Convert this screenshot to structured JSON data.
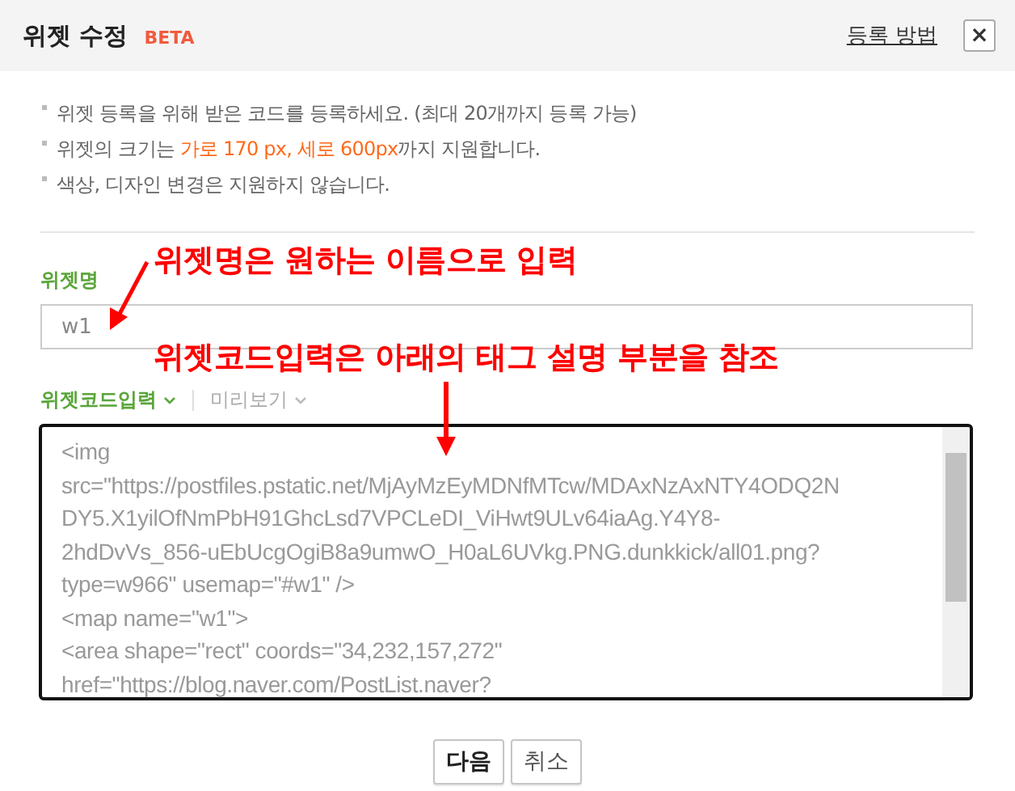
{
  "header": {
    "title": "위젯 수정",
    "badge": "BETA",
    "help_link": "등록 방법",
    "close_label": "×"
  },
  "notes": [
    "위젯 등록을 위해 받은 코드를 등록하세요. (최대 20개까지 등록 가능)",
    "위젯의 크기는 **가로 170 px, 세로 600px**까지 지원합니다.",
    "색상, 디자인 변경은 지원하지 않습니다."
  ],
  "name_field": {
    "label": "위젯명",
    "value": "w1"
  },
  "code_tabs": [
    {
      "label": "위젯코드입력",
      "selected": true
    },
    {
      "label": "미리보기",
      "selected": false
    }
  ],
  "code_lines": [
    "<img",
    "src=\"https://postfiles.pstatic.net/MjAyMzEyMDNfMTcw/MDAxNzAxNTY4ODQ2N",
    "DY5.X1yilOfNmPbH91GhcLsd7VPCLeDI_ViHwt9ULv64iaAg.Y4Y8-",
    "2hdDvVs_856-uEbUcgOgiB8a9umwO_H0aL6UVkg.PNG.dunkkick/all01.png?",
    "type=w966\" usemap=\"#w1\" />",
    "<map name=\"w1\">",
    "<area shape=\"rect\" coords=\"34,232,157,272\"",
    "href=\"https://blog.naver.com/PostList.naver?"
  ],
  "annotations": [
    "위젯명은 원하는 이름으로 입력",
    "위젯코드입력은 아래의 태그 설명 부분을 참조"
  ],
  "buttons": [
    {
      "label": "다음",
      "kind": "primary"
    },
    {
      "label": "취소",
      "kind": "secondary"
    }
  ]
}
